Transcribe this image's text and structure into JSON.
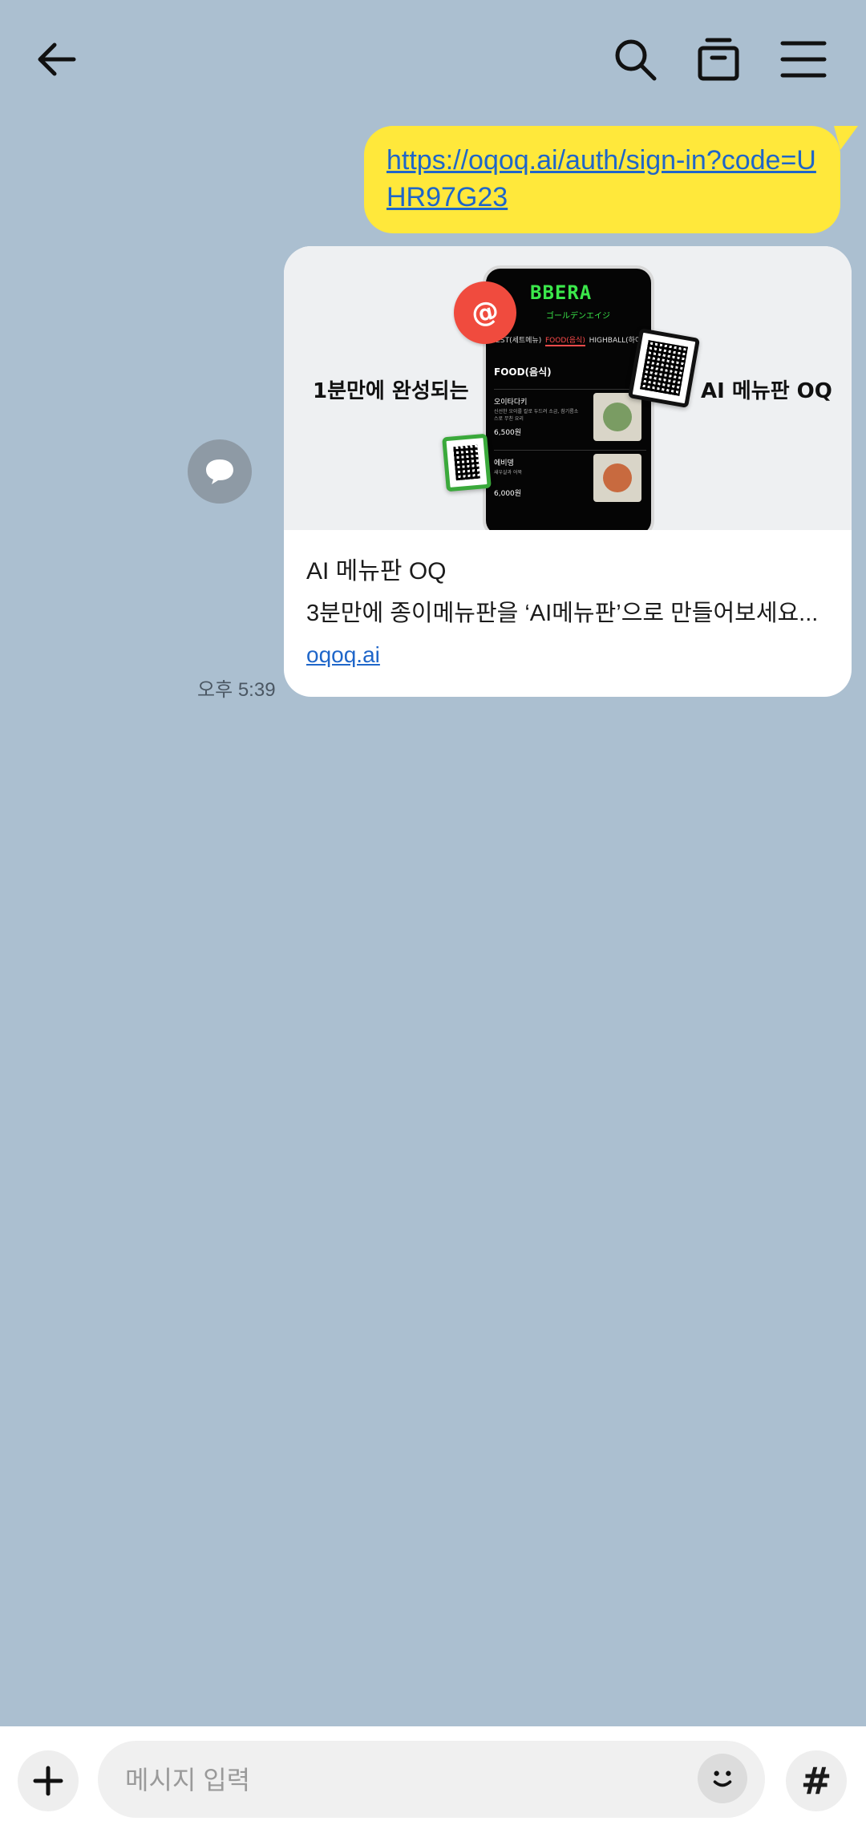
{
  "header": {
    "back_icon": "arrow-left-icon",
    "search_icon": "search-icon",
    "drawer_icon": "archive-icon",
    "menu_icon": "hamburger-menu-icon"
  },
  "messages": {
    "outgoing_link": "https://oqoq.ai/auth/sign-in?code=UHR97G23",
    "card": {
      "image_left_text": "1분만에 완성되는",
      "image_right_text": "AI 메뉴판 OQ",
      "phone": {
        "logo": "BBERA",
        "subtitle": "ゴールデンエイジ",
        "tabs": [
          "BEST(세트메뉴)",
          "FOOD(음식)",
          "HIGHBALL(하이볼)"
        ],
        "section": "FOOD(음식)",
        "items": [
          {
            "name": "오이타다키",
            "desc": "신선한 오이를 칼로 두드려 소금, 참기름소스로 무친 요리",
            "price": "6,500원"
          },
          {
            "name": "에비뎅",
            "desc": "새우살과 어묵",
            "price": "6,000원"
          }
        ]
      },
      "sticker_text": "@",
      "title": "AI 메뉴판 OQ",
      "description": "3분만에 종이메뉴판을 ‘AI메뉴판’으로 만들어보세요...",
      "domain": "oqoq.ai"
    },
    "time": "오후 5:39",
    "share_icon": "speech-bubble-icon"
  },
  "composer": {
    "plus_icon": "plus-icon",
    "placeholder": "메시지 입력",
    "emoji_icon": "emoji-icon",
    "hash_label": "#"
  },
  "colors": {
    "background": "#abbfd0",
    "outgoing_bubble": "#ffe83b",
    "link": "#1f66c9"
  }
}
